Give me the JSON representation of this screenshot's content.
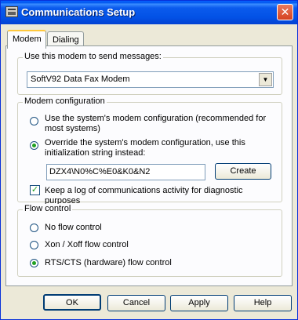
{
  "window": {
    "title": "Communications Setup",
    "close_glyph": "✕"
  },
  "tabs": [
    {
      "label": "Modem"
    },
    {
      "label": "Dialing"
    }
  ],
  "modem_select": {
    "legend": "Use this modem to send messages:",
    "value": "SoftV92 Data Fax Modem",
    "arrow_glyph": "▼"
  },
  "modem_config": {
    "legend": "Modem configuration",
    "option_system": "Use the system's modem configuration (recommended for most systems)",
    "option_override": "Override the system's modem configuration, use this initialization string instead:",
    "init_string": "DZX4\\N0%C%E0&K0&N2",
    "create_label": "Create",
    "log_label": "Keep a log of communications activity for diagnostic purposes",
    "log_checked_glyph": "✓"
  },
  "flow_control": {
    "legend": "Flow control",
    "options": [
      "No flow control",
      "Xon / Xoff flow control",
      "RTS/CTS (hardware) flow control"
    ],
    "selected": "RTS/CTS (hardware) flow control"
  },
  "buttons": {
    "ok": "OK",
    "cancel": "Cancel",
    "apply": "Apply",
    "help": "Help"
  },
  "icons": {
    "title": "modem-app-icon",
    "close": "close-icon",
    "dropdown": "chevron-down-icon"
  }
}
